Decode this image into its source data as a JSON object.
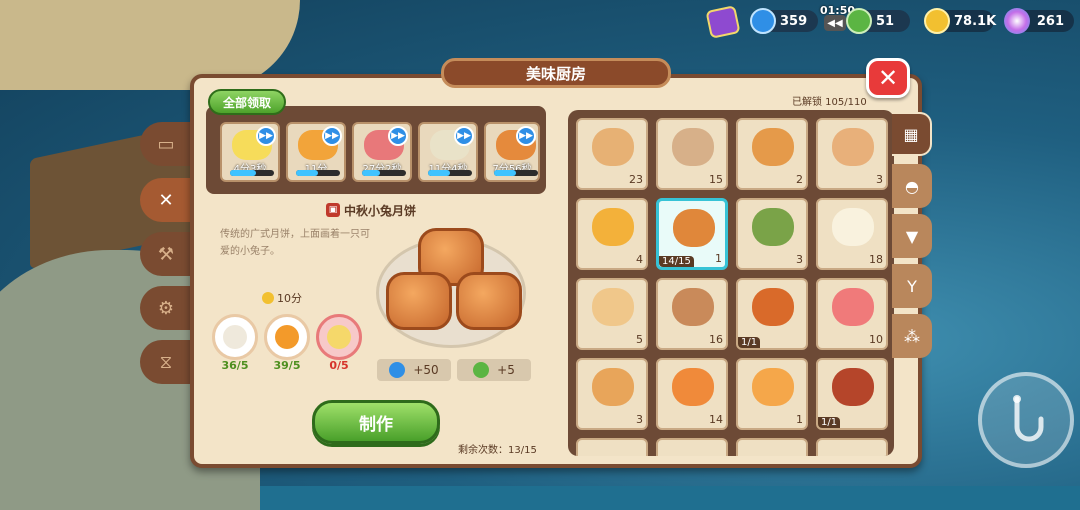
{
  "top": {
    "energy": "359",
    "clock": "01:50",
    "tool_count": "51",
    "gold": "78.1K",
    "gems": "261"
  },
  "window_title": "美味厨房",
  "collect_all": "全部领取",
  "queue": [
    {
      "time": "4分3秒",
      "progress": 0.6,
      "color": "#f6dc5a"
    },
    {
      "time": "11分",
      "progress": 0.5,
      "color": "#f2a43a"
    },
    {
      "time": "27分2秒",
      "progress": 0.4,
      "color": "#e8787a"
    },
    {
      "time": "11分4秒",
      "progress": 0.5,
      "color": "#e9e2c8"
    },
    {
      "time": "7分56秒",
      "progress": 0.5,
      "color": "#e58a3c"
    }
  ],
  "recipe": {
    "name": "中秋小兔月饼",
    "description": "传统的广式月饼，上面画着一只可爱的小兔子。",
    "time": "10分",
    "ingredients": [
      {
        "count": "36/5",
        "color": "#efe9dc",
        "lacking": false,
        "count_color": "#4e8f1f"
      },
      {
        "count": "39/5",
        "color": "#f39a2a",
        "lacking": false,
        "count_color": "#4e8f1f"
      },
      {
        "count": "0/5",
        "color": "#f5d86a",
        "lacking": true,
        "count_color": "#d6342a"
      }
    ],
    "reward_energy": "+50",
    "reward_tools": "+5",
    "make_label": "制作",
    "remaining": "剩余次数：13/15"
  },
  "unlocked": "已解锁  105/110",
  "dishes": [
    {
      "count": "23",
      "color": "#e7b174"
    },
    {
      "count": "15",
      "color": "#d7b089"
    },
    {
      "count": "2",
      "color": "#e59a4a"
    },
    {
      "count": "3",
      "color": "#e8b07a"
    },
    {
      "count": "4",
      "color": "#f3b13a"
    },
    {
      "count": "1",
      "color": "#e0873a",
      "progress": "14/15",
      "selected": true
    },
    {
      "count": "3",
      "color": "#7aa348"
    },
    {
      "count": "18",
      "color": "#f9f2de"
    },
    {
      "count": "5",
      "color": "#f0c78a"
    },
    {
      "count": "16",
      "color": "#c98a5a"
    },
    {
      "count": "",
      "color": "#d96a2a",
      "progress": "1/1"
    },
    {
      "count": "10",
      "color": "#f07a7a"
    },
    {
      "count": "3",
      "color": "#e8a55a"
    },
    {
      "count": "14",
      "color": "#f08a3a"
    },
    {
      "count": "1",
      "color": "#f5a74a"
    },
    {
      "count": "",
      "color": "#b5452a",
      "progress": "1/1"
    }
  ],
  "icons": [
    "gift-icon",
    "energy-icon",
    "tool-icon",
    "gold-coin-icon",
    "gem-icon",
    "close-icon",
    "fork-knife-icon",
    "grid-icon",
    "burger-icon",
    "icecream-icon",
    "cocktail-icon",
    "spice-icon",
    "fish-hook-icon"
  ]
}
